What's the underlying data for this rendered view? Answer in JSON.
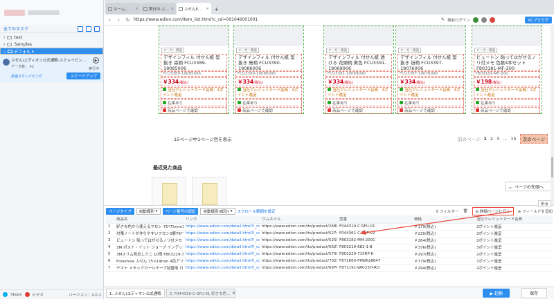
{
  "sidebar": {
    "header": "全てのタスク",
    "tree": [
      {
        "label": "test"
      },
      {
        "label": "Samples"
      },
      {
        "label": "デフォルト"
      }
    ],
    "task": {
      "title": "ふせん(エディオン公式通販-スクレイピン...",
      "data_label": "データ数",
      "data_count": "42",
      "status": "実行中",
      "schedule": "高速スクレイピング",
      "speed_button": "スピードアップ"
    },
    "footer": {
      "brand": "Skype",
      "video": "ビデオ",
      "version": "バージョン：4.0.2"
    }
  },
  "browser": {
    "tabs": [
      {
        "label": "ホーム..."
      },
      {
        "label": "実行中-ふ..."
      },
      {
        "label": "ふせんE..."
      }
    ],
    "url": "https://www.edion.com/item_list.html?c_cd=001046001001",
    "login": "事前ログイン",
    "mode": "PCブラウザ"
  },
  "products": [
    {
      "badge": "メーカー発送",
      "name": "デザインフィル 付せん紙 型抜き 森柄 FCU3389-19085006",
      "code": "FCU3389-19085006",
      "price": "￥334",
      "tax": "(税込)",
      "card": "当社クレジットカード会員：4ポイント進呈",
      "stock": "在庫あり",
      "link": "商品ページで確認"
    },
    {
      "badge": "メーカー発送",
      "name": "デザインフィル 付せん紙 型抜き 鳥柄 FCU3390-19086006",
      "code": "FCU3390-19086006",
      "price": "￥334",
      "tax": "(税込)",
      "card": "当社クレジットカード会員：4ポイント進呈",
      "stock": "在庫あり",
      "link": "商品ページで確認"
    },
    {
      "badge": "メーカー発送",
      "name": "デザインフィル 付せん紙 透ける 花頭柄 黄色 FCU3391-19069006",
      "code": "FCU3391-19069006",
      "price": "￥334",
      "tax": "(税込)",
      "card": "当社クレジットカード会員：4ポイント進呈",
      "stock": "在庫あり",
      "link": "商品ページで確認"
    },
    {
      "badge": "メーカー発送",
      "name": "デザインフィル 付せん紙 型抜き 街柄 FCU3397-19076006",
      "code": "FCU3397-19076006",
      "price": "￥334",
      "tax": "(税込)",
      "card": "当社クレジットカード会員：4ポイント進呈",
      "stock": "在庫あり",
      "link": "商品ページで確認"
    },
    {
      "badge": "メーカー発送",
      "name": "ビュートン 貼ってはがせるノリ付メモ 色帳4本セット F803181-MF-200",
      "code": "F803181-MF-200",
      "price": "￥198",
      "tax": "(税込)",
      "card": "当社クレジットカード会員：2ポイント進呈",
      "stock": "在庫あり",
      "link": "商品ページで確認"
    }
  ],
  "pager": {
    "info": "15ページ中1ページ目を表示",
    "prev": "前のページ",
    "pages": [
      "1",
      "2",
      "3",
      "...",
      "15"
    ],
    "next": "次のページ"
  },
  "recent": "最近見た商品",
  "to_top": "ページの先頭へ",
  "panel": {
    "fold": "折る",
    "tag1": "ページタイプ",
    "sel1": "自動識別",
    "tag2": "ページ番号の認証",
    "sel2": "自動識別(成功)",
    "scroll_link": "スクロール範囲を設定",
    "filter": "フィルター",
    "detail": "詳細ページに行く",
    "add_field": "フィールドを追加",
    "columns": [
      "",
      "商品名",
      "リンク",
      "サムネイル",
      "型番",
      "価格",
      "当社クレジットカード会員"
    ],
    "rows": [
      [
        "1",
        "好きな色から使えるフセン 75*75mm100枚",
        "https://www.edion.com/detail.html?i_cd=0...",
        "https://www.edion.com/ito/product/2686/02...",
        "F044319-C-SFU-01",
        "￥179(税込)",
        "2ポイント進呈"
      ],
      [
        "2",
        "付箋ノートが作りやすいフセン3層76*76 2...",
        "https://www.edion.com/detail.html?i_cd=0...",
        "https://www.edion.com/ito/product/5274/02...",
        "F044361-C-FNF-02",
        "￥220(税込)",
        "2ポイント進呈"
      ],
      [
        "3",
        "ビュートン 貼ってはがせるノリ付メモ 4色...",
        "https://www.edion.com/detail.html?i_cd=0...",
        "https://www.edion.com/ito/product/5250/02...",
        "F803182-MM-200C",
        "￥264(税込)",
        "2ポイント進呈"
      ],
      [
        "4",
        "3M ポスト・イット ジョーブ インデックス...",
        "https://www.edion.com/detail.html?i_cd=0...",
        "https://www.edion.com/ito/product/5625/02...",
        "F803219-682-1-B",
        "￥376(税込)",
        "3ポイント進呈"
      ],
      [
        "5",
        "3Mスリム見出しミニ 10冊 F803229-715R...",
        "https://www.edion.com/detail.html?i_cd=0...",
        "https://www.edion.com/ito/product/5700/02...",
        "F803229-715RP-K",
        "￥297(税込)",
        "2ポイント進呈"
      ],
      [
        "6",
        "Foreshow ふせん 75×14mm 4色アソート...",
        "https://www.edion.com/detail.html?i_cd=0...",
        "https://www.edion.com/ito/product/7025/02...",
        "F871660-FRW628647",
        "￥779(税込)",
        "7ポイント進呈"
      ],
      [
        "7",
        "ヤマト メモックロールテープ詰替用 ロール...",
        "https://www.edion.com/detail.html?i_cd=0...",
        "https://www.edion.com/ito/product/6976/02...",
        "F871191-WR-25H-RO",
        "￥294(税込)",
        "2ポイント進呈"
      ]
    ],
    "bottom_tabs": [
      {
        "label": "1. ふせん(エディオン公式通販"
      },
      {
        "label": "2. F044319-C-SFU-01 好きな色..."
      }
    ],
    "start": "▶ 起動",
    "save": "保存"
  }
}
